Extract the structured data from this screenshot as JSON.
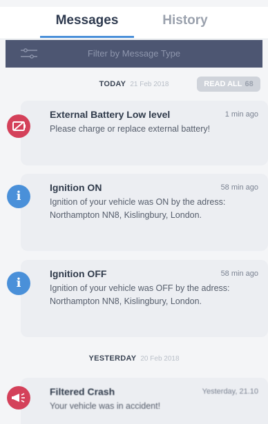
{
  "tabs": [
    {
      "label": "Messages",
      "active": true
    },
    {
      "label": "History",
      "active": false
    }
  ],
  "filter": {
    "placeholder": "Filter by Message Type",
    "icon": "filter-sliders-icon"
  },
  "sections": [
    {
      "day": "TODAY",
      "date": "21 Feb 2018",
      "read_all_label": "READ ALL",
      "unread_count": "68"
    },
    {
      "day": "YESTERDAY",
      "date": "20 Feb 2018"
    }
  ],
  "messages": [
    {
      "title": "External Battery Low level",
      "time": "1 min ago",
      "body": "Please charge or replace external battery!",
      "icon": "battery-low-icon",
      "color": "#d4415a"
    },
    {
      "title": "Ignition ON",
      "time": "58 min ago",
      "body": "Ignition of your vehicle was ON by the adress: Northampton NN8, Kislingbury, London.",
      "icon": "info-icon",
      "color": "#4a90d9"
    },
    {
      "title": "Ignition OFF",
      "time": "58 min ago",
      "body": "Ignition of your vehicle was OFF by the adress: Northampton NN8, Kislingbury, London.",
      "icon": "info-icon",
      "color": "#4a90d9"
    },
    {
      "title": "Filtered Crash",
      "time": "Yesterday, 21.10",
      "body": "Your vehicle was in accident!",
      "icon": "megaphone-icon",
      "color": "#d4415a"
    }
  ]
}
